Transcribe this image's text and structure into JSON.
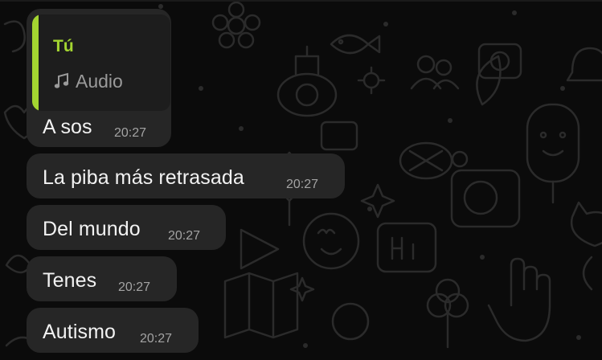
{
  "theme": {
    "background": "#0b0b0b",
    "bubble": "#262626",
    "quote_accent": "#a4d531",
    "text": "#f2f2f2",
    "time": "#a3a3a3"
  },
  "reply": {
    "sender": "Tú",
    "media_icon": "music-note-icon",
    "media_label": "Audio"
  },
  "messages": [
    {
      "text": "A sos",
      "time": "20:27"
    },
    {
      "text": "La piba más retrasada",
      "time": "20:27"
    },
    {
      "text": "Del mundo",
      "time": "20:27"
    },
    {
      "text": "Tenes",
      "time": "20:27"
    },
    {
      "text": "Autismo",
      "time": "20:27"
    }
  ]
}
